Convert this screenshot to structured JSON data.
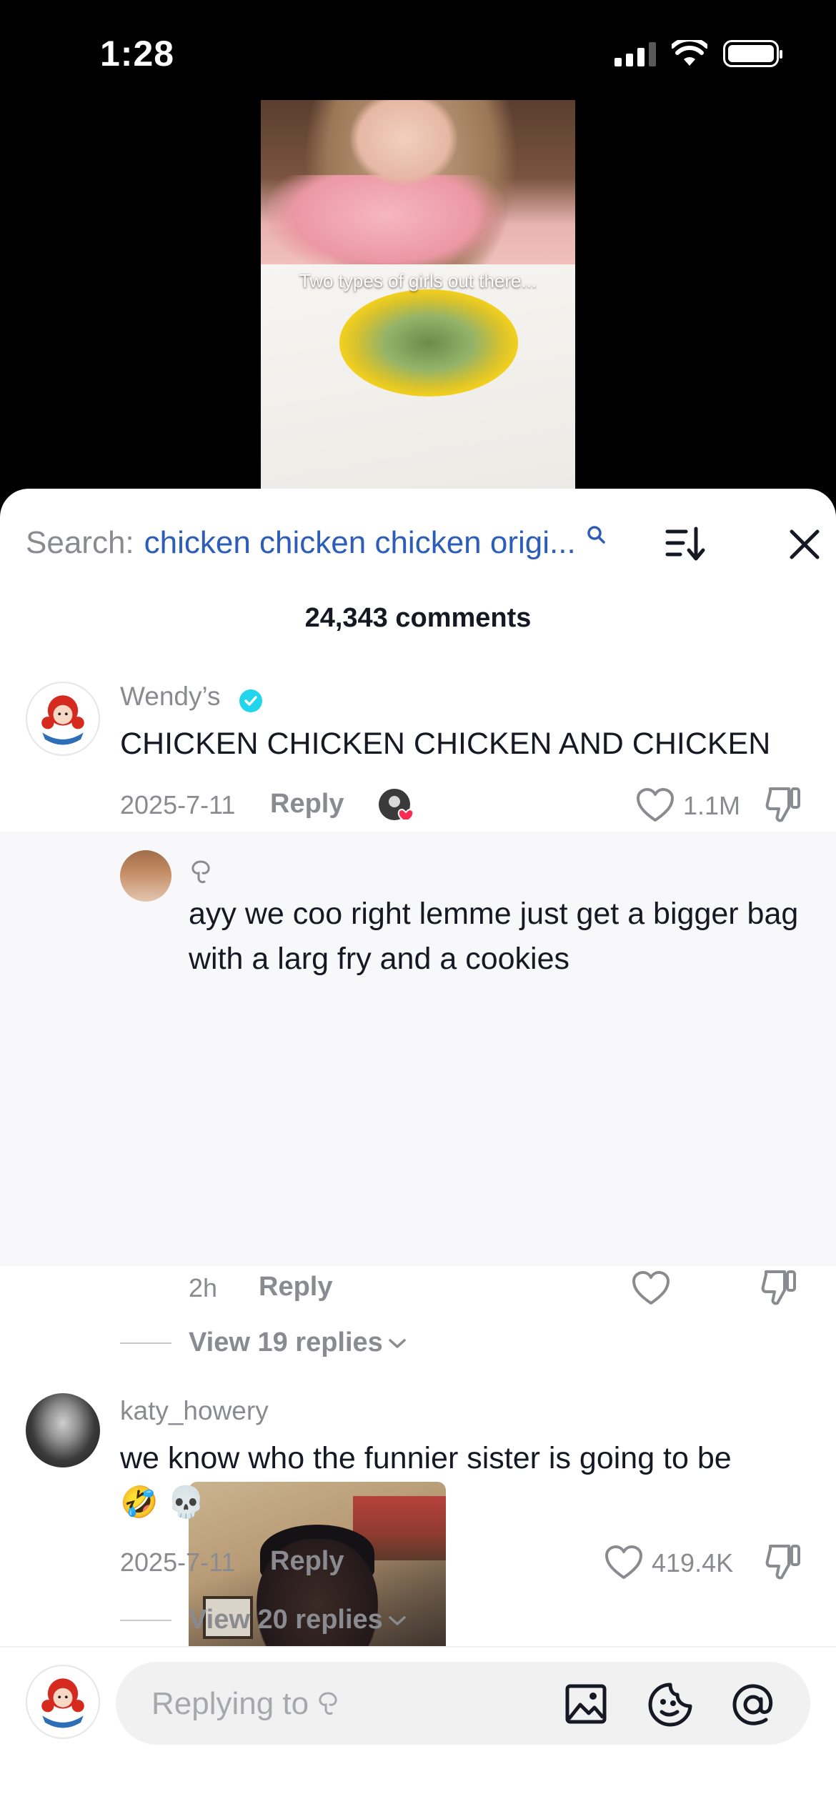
{
  "status_bar": {
    "time": "1:28"
  },
  "video": {
    "overlay_text": "Two types of girls out there..."
  },
  "search": {
    "label": "Search:",
    "query": "chicken chicken chicken origi..."
  },
  "comments_count": "24,343 comments",
  "comments": [
    {
      "username": "Wendy’s",
      "verified": true,
      "text": "CHICKEN CHICKEN CHICKEN AND CHICKEN",
      "date": "2025-7-11",
      "reply_label": "Reply",
      "likes": "1.1M"
    },
    {
      "username": "katy_howery",
      "text": "we know who the funnier sister is going to be",
      "emoji": "🤣 💀",
      "date": "2025-7-11",
      "reply_label": "Reply",
      "likes": "419.4K",
      "view_replies": "View 20 replies"
    }
  ],
  "reply": {
    "text": "ayy we coo right lemme just get a bigger bag with a larg fry and a cookies",
    "time": "2h",
    "reply_label": "Reply",
    "view_replies": "View 19 replies"
  },
  "input": {
    "placeholder": "Replying to"
  },
  "colors": {
    "accent_blue": "#2b5db9",
    "verified": "#20d5ec",
    "muted_text": "#8a8b91",
    "heart_red": "#fe2c55"
  }
}
